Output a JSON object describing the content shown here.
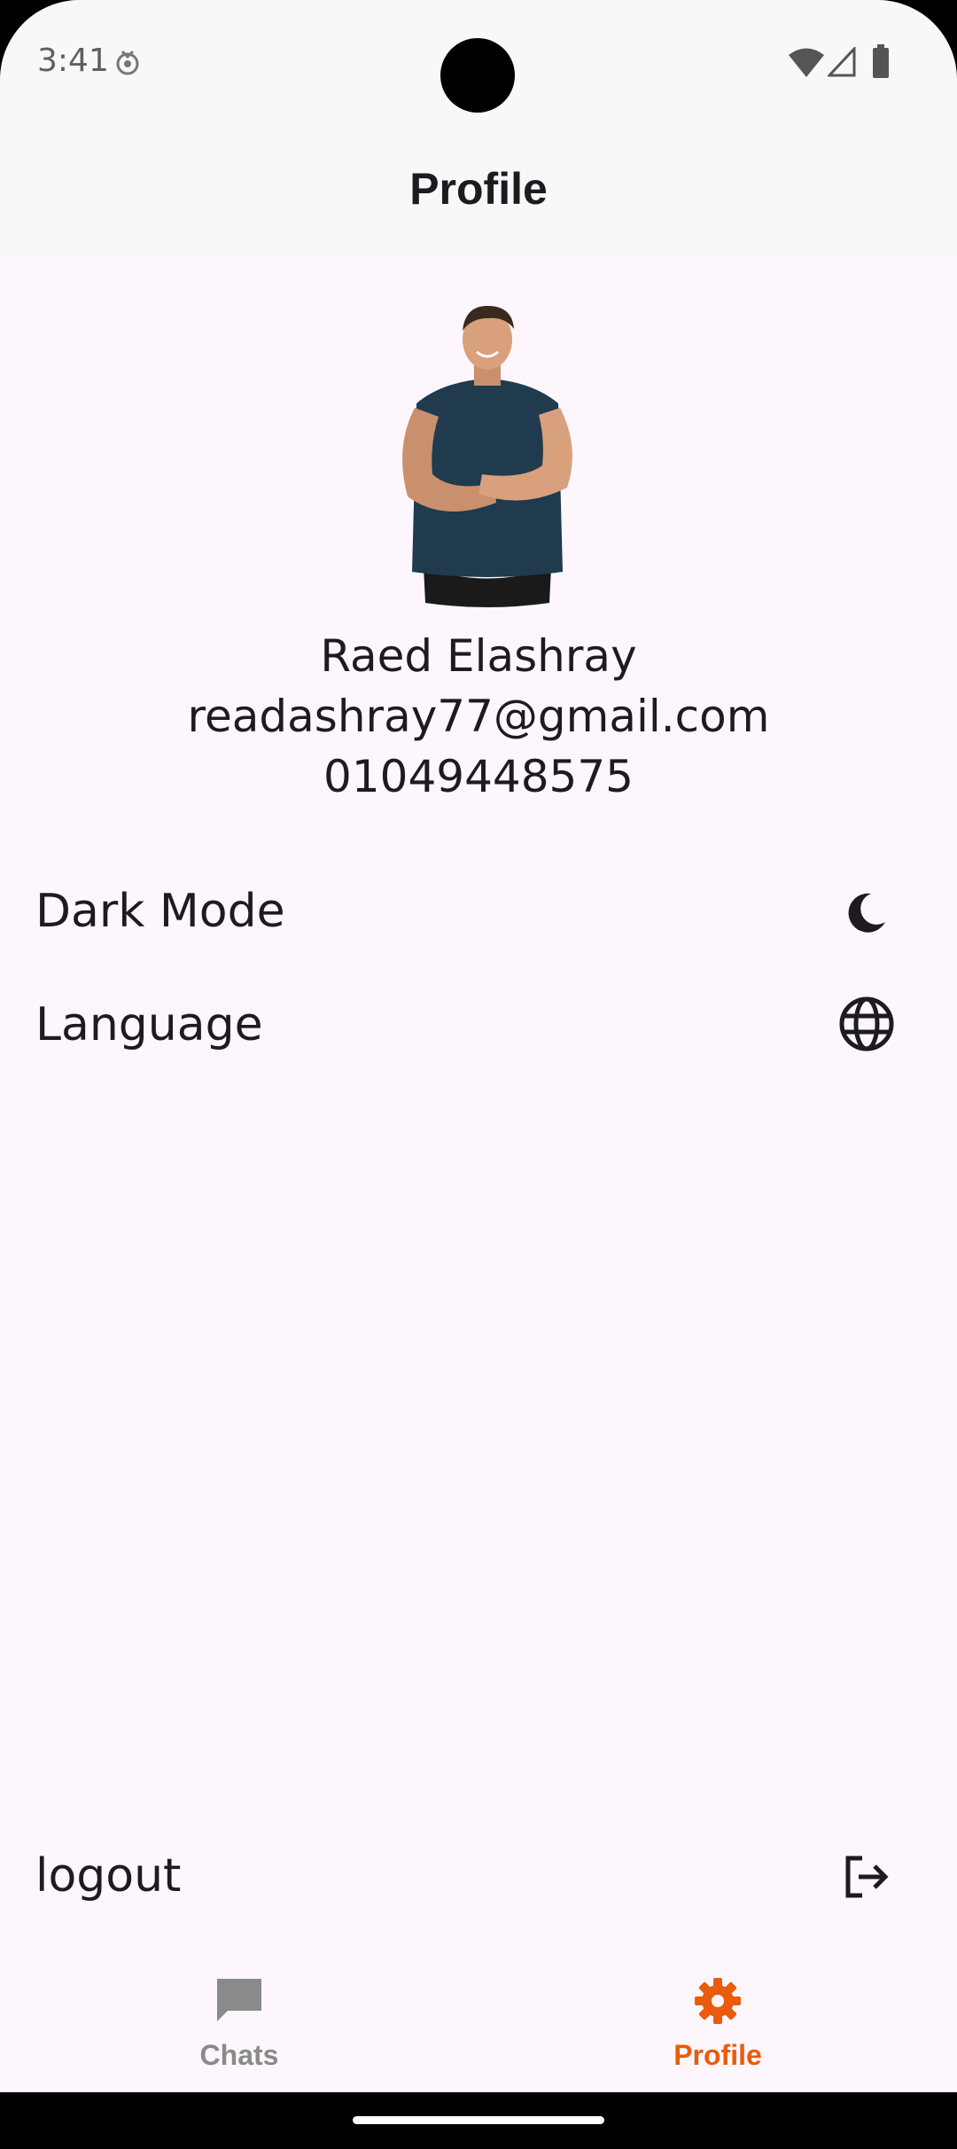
{
  "status_bar": {
    "time": "3:41"
  },
  "app_bar": {
    "title": "Profile"
  },
  "profile": {
    "name": "Raed Elashray",
    "email": "readashray77@gmail.com",
    "phone": "01049448575"
  },
  "settings": {
    "dark_mode": {
      "label": "Dark Mode",
      "icon": "moon-icon"
    },
    "language": {
      "label": "Language",
      "icon": "globe-icon"
    },
    "logout": {
      "label": "logout",
      "icon": "logout-icon"
    }
  },
  "bottom_nav": {
    "items": [
      {
        "label": "Chats",
        "icon": "chat-icon",
        "selected": false
      },
      {
        "label": "Profile",
        "icon": "gear-icon",
        "selected": true
      }
    ],
    "selected_color": "#ea5b0c",
    "unselected_color": "#8a8a8a"
  }
}
